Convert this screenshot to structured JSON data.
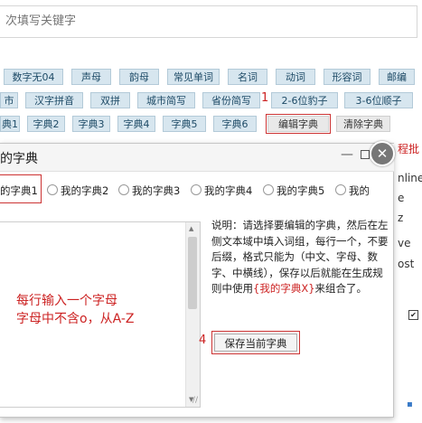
{
  "search": {
    "placeholder": "次填写关键字"
  },
  "tags": {
    "row1": [
      "数字无04",
      "声母",
      "韵母",
      "常见单词",
      "名词",
      "动词",
      "形容词",
      "邮编"
    ],
    "row2": [
      "市",
      "汉字拼音",
      "双拼",
      "城市简写",
      "省份简写",
      "2-6位豹子",
      "3-6位顺子"
    ],
    "row3": [
      "字典2",
      "字典3",
      "字典4",
      "字典5",
      "字典6",
      "编辑字典",
      "清除字典"
    ],
    "row3_lead": "典1",
    "annotation_1": "1"
  },
  "dialog": {
    "title": "我的字典",
    "title_visible": "的字典",
    "minimize": "—",
    "close": "✕",
    "radios": [
      "的字典1",
      "我的字典2",
      "我的字典3",
      "我的字典4",
      "我的字典5",
      "我的"
    ],
    "textarea_note_line1": "每行输入一个字母",
    "textarea_note_line2": "字母中不含o，从A-Z",
    "explain_before": "说明：请选择要编辑的字典，然后在左侧文本域中填入词组，每行一个，不要后缀，格式只能为（中文、字母、数字、中横线），保存以后就能在生成规则中使用",
    "explain_link": "{我的字典X}",
    "explain_after": "来组合了。",
    "annotation_4": "4",
    "save_label": "保存当前字典"
  },
  "right_strip": {
    "red_text": "程批",
    "line1": "nline",
    "line2": "e",
    "line3": "z",
    "line4": "ve",
    "line5": "ost"
  }
}
